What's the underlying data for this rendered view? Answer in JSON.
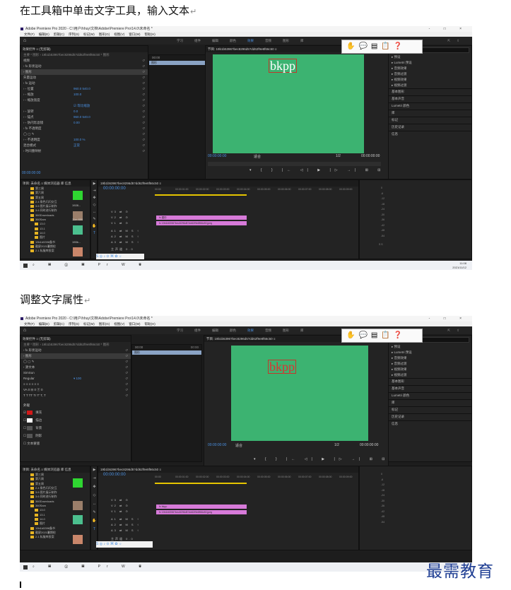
{
  "doc": {
    "heading1": "在工具箱中单击文字工具，输入文本",
    "heading2": "调整文字属性",
    "paragraph_mark": "↵",
    "watermark": "最需教育"
  },
  "app": {
    "title": "Adobe Premiere Pro 2020 - C:\\用户\\hhuy\\文档\\Adobe\\Premiere Pro\\14.0\\未命名 *",
    "menu": [
      "文件(F)",
      "编辑(E)",
      "剪辑(C)",
      "序列(S)",
      "标记(M)",
      "图形(G)",
      "视图(V)",
      "窗口(W)",
      "帮助(H)"
    ],
    "workspaces": [
      "学习",
      "组件",
      "编辑",
      "颜色",
      "效果",
      "音频",
      "图形",
      "库"
    ],
    "active_workspace": "效果",
    "window_controls": "-  □  ×"
  },
  "shot1": {
    "panel_tabs": "效果控件  ≡   (无剪辑)",
    "clip_path": "主要 * 图形  ›  19b1b5396?bec8296d5?dd62f9e8f66c50 * 图形",
    "seq_tab": "19b1b5396?bec8296d5?dd62f9e8f66c50",
    "effect_rows": [
      {
        "label": "视频",
        "value": "",
        "hl": false
      },
      {
        "label": "› fx 形状运动",
        "value": "",
        "hl": false
      },
      {
        "label": "› 图形",
        "value": "",
        "hl": true
      },
      {
        "label": "矢量运动",
        "value": "",
        "hl": false
      },
      {
        "label": "‹ fx 运动",
        "value": "",
        "hl": false
      },
      {
        "label": "  › ◦ 位置",
        "value": "960.0   540.0",
        "hl": false
      },
      {
        "label": "  › ◦ 缩放",
        "value": "100.0",
        "hl": false
      },
      {
        "label": "  › ◦ 缩放宽度",
        "value": "",
        "hl": false
      },
      {
        "label": "",
        "value": "☑ 等比缩放",
        "hl": false
      },
      {
        "label": "  › ◦ 旋转",
        "value": "0.0",
        "hl": false
      },
      {
        "label": "  › ◦ 锚点",
        "value": "960.0   540.0",
        "hl": false
      },
      {
        "label": "  › ◦ 防闪烁滤镜",
        "value": "0.00",
        "hl": false
      },
      {
        "label": "› fx 不透明度",
        "value": "",
        "hl": false
      },
      {
        "label": "  ◯ ▢ ✎",
        "value": "",
        "hl": false
      },
      {
        "label": "  › ◦ 不透明度",
        "value": "100.0 %",
        "hl": false
      },
      {
        "label": "    混合模式",
        "value": "正常",
        "hl": false
      },
      {
        "label": "› 时间重映射",
        "value": "",
        "hl": false
      }
    ],
    "timecode_left": "00:00:00:00",
    "src_times": [
      "00:00",
      "00:00"
    ],
    "program_tab": "节目: 19b1b5396?bec8296d5?dd62f9e8f66c50  ≡",
    "text": "bkpp",
    "prog_tc": "00:00:00:00",
    "fit": "适合",
    "res": "1/2",
    "prog_end": "00:00:00:00",
    "transport": "▾ { } |← ◁| ▶ |▷ →| ⊞ ⊟ ⊡ ⊠ +",
    "project_tabs": "项目: 未命名  ≡  媒体浏览器  库  信息",
    "project_items": [
      "第三周",
      "第六周",
      "第五周",
      "2.4 角色闪闪交互",
      "3.6 图片展示制作",
      "3.6 同时进行制作",
      "360Downloads",
      "360Sam",
      "13.0",
      "13.1",
      "14.0",
      "图片",
      "19b1b5396备书",
      "截屏2021暑期检",
      "2.1 私服库投案"
    ],
    "thumb_labels": [
      "1928...",
      "11m 600",
      "190b..."
    ],
    "timeline_tab": "19b1b5396?bec8296d5?dd62f9e8f66c50  ≡",
    "timeline_tc": "00:00:00:00",
    "ruler": [
      "00:00",
      "00:00:01:00",
      "00:00:02:00",
      "00:00:03:00",
      "00:00:04:00",
      "00:00:05:00",
      "00:00:06:00",
      "00:00:07:00",
      "00:00:08:00",
      "00:00:09:00"
    ],
    "tracks_v": [
      "V3 ⇄ ⊙",
      "V2 ⇄ ⊙",
      "V1 ⇄ ⊙"
    ],
    "tracks_a": [
      "A1 ⇄ M S ♀",
      "A2 ⇄ M S ♀",
      "A3 ⇄ M S ♀"
    ],
    "master": "主声道   0.0",
    "clip_graphic": "fx 图形",
    "clip_image": "fx 19b1b5396?bec8296d5?dd62f9e8f66c50.jpeg",
    "meter_labels": [
      "0",
      "-6",
      "-12",
      "-18",
      "-24",
      "-30",
      "-36",
      "-42",
      "-48",
      "-54"
    ],
    "meter_db": "S  S",
    "right_panel": [
      "▸ 预设",
      "▸ Lumetri 预设",
      "▸ 音频效果",
      "▸ 音频过渡",
      "▸ 视频效果",
      "▸ 视频过渡",
      "基本图形",
      "基本声音",
      "Lumetri 颜色",
      "库",
      "标记",
      "历史记录",
      "信息"
    ],
    "taskbar_time": "11:08",
    "taskbar_date": "2021/11/12"
  },
  "shot2": {
    "panel_tabs": "效果控件  ≡   (无剪辑)",
    "clip_path": "主要 * 图形  ›  19b1b5396?bec8296d5?dd62f9e8f66c50 * 图形",
    "effect_rows": [
      {
        "label": "› fx 形状运动",
        "value": "",
        "hl": false
      },
      {
        "label": "› 图形",
        "value": "",
        "hl": true
      },
      {
        "label": "  ◯ ▢ ✎",
        "value": "",
        "hl": false
      },
      {
        "label": "  ‹ 源文本",
        "value": "",
        "hl": false
      },
      {
        "label": "  SimSun",
        "value": "",
        "hl": false
      },
      {
        "label": "  Regular",
        "value": "▾  100",
        "hl": false
      },
      {
        "label": "  ≡ ≡ ≡  ≡ ≡ ≡",
        "value": "",
        "hl": false
      },
      {
        "label": "  VA 0  ⊟ 0  Ⓣ 0",
        "value": "",
        "hl": false
      },
      {
        "label": "  T T TT Tr T' T, T",
        "value": "",
        "hl": false
      }
    ],
    "appearance_label": "外观",
    "appearance": [
      {
        "label": "填充",
        "color": "#d11919",
        "checked": true
      },
      {
        "label": "描边",
        "color": "#ffffff",
        "checked": false
      },
      {
        "label": "背景",
        "color": "#555555",
        "checked": false
      },
      {
        "label": "阴影",
        "color": "#555555",
        "checked": false
      },
      {
        "label": "文本蒙版",
        "color": "",
        "checked": false
      }
    ],
    "text": "bkpp",
    "clip_graphic": "fx bkpp",
    "taskbar_time": "",
    "taskbar_date": ""
  },
  "colors": {
    "viewer_green": "#3cb371",
    "clip_pink": "#d77ad9",
    "accent_blue": "#4a90e2",
    "text_red": "#c0392b"
  }
}
